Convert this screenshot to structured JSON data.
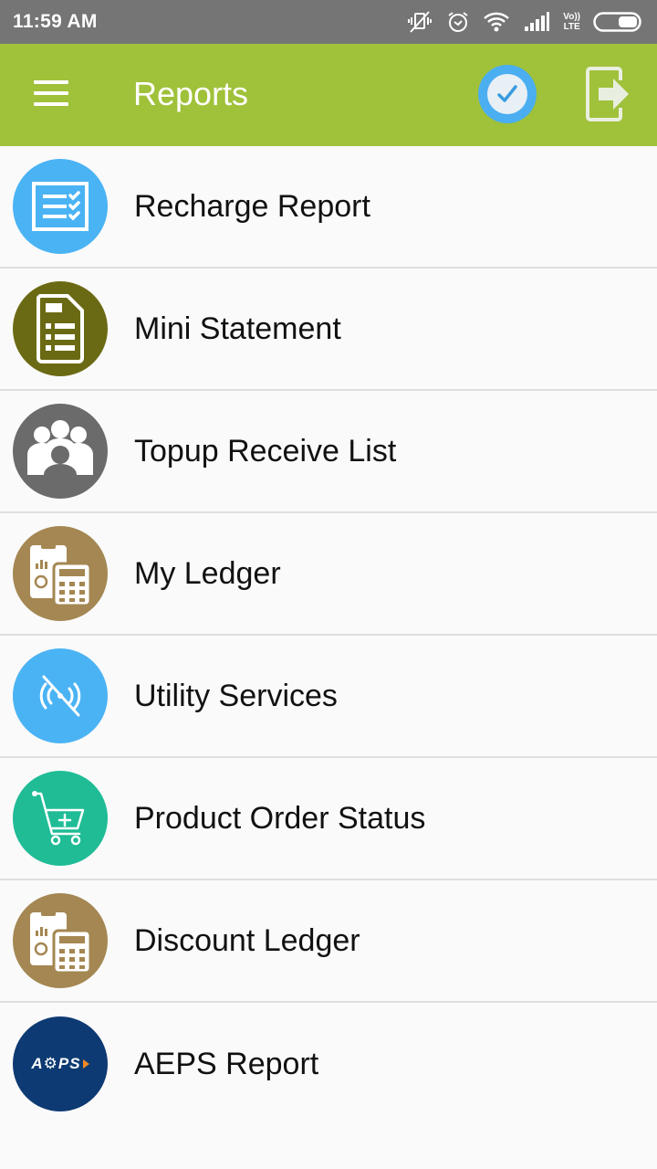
{
  "status_bar": {
    "time": "11:59 AM",
    "icons": [
      "vibrate-off-icon",
      "alarm-icon",
      "wifi-icon",
      "signal-icon",
      "volte-icon",
      "battery-icon"
    ],
    "volte_label_top": "Vo))",
    "volte_label_bottom": "LTE"
  },
  "app_bar": {
    "title": "Reports",
    "background": "#a0c13a",
    "actions": [
      "check-circle-icon",
      "logout-icon"
    ]
  },
  "list": {
    "items": [
      {
        "label": "Recharge Report",
        "icon": "checklist-icon",
        "color": "#4ab3f4"
      },
      {
        "label": "Mini Statement",
        "icon": "document-list-icon",
        "color": "#6b6a14"
      },
      {
        "label": "Topup Receive List",
        "icon": "users-group-icon",
        "color": "#6b6b6b"
      },
      {
        "label": "My Ledger",
        "icon": "ledger-calculator-icon",
        "color": "#a48752"
      },
      {
        "label": "Utility Services",
        "icon": "signal-off-icon",
        "color": "#4ab3f4"
      },
      {
        "label": "Product Order Status",
        "icon": "cart-add-icon",
        "color": "#1fbc96"
      },
      {
        "label": "Discount Ledger",
        "icon": "ledger-calculator-icon",
        "color": "#a48752"
      },
      {
        "label": "AEPS Report",
        "icon": "aeps-logo-icon",
        "color": "#0d3a72",
        "logo_text": "A⚙PS"
      }
    ]
  }
}
